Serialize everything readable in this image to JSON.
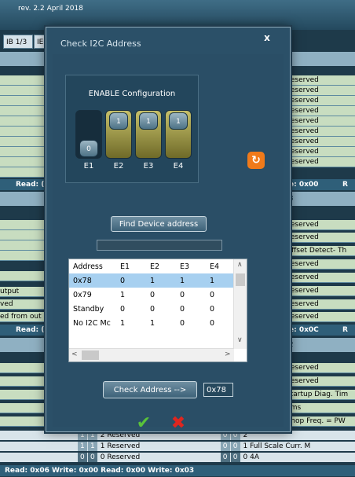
{
  "app": {
    "revision": "rev. 2.2 April 2018",
    "tabs": [
      "IB 1/3",
      "IE"
    ]
  },
  "background": {
    "right_rows_top": [
      "Reserved",
      "Reserved",
      "Reserved",
      "Reserved",
      "Reserved",
      "Reserved",
      "Reserved",
      "Reserved",
      "Reserved"
    ],
    "read_bar_1_left": "Read: (",
    "read_bar_1_right": "e: 0x00",
    "read_bar_1_far": "R",
    "section_1_num": "3",
    "right_rows_mid": [
      "Reserved",
      "Reserved",
      "Offset Detect- Th",
      "Reserved",
      "Reserved",
      "Reserved",
      "Reserved",
      "Reserved",
      "Reserved"
    ],
    "left_rows_mid": [
      "",
      "",
      "",
      "",
      "",
      "utput",
      "ved",
      "ed from out"
    ],
    "read_bar_2_left": "Read: (",
    "read_bar_2_right": "e: 0x0C",
    "read_bar_2_far": "R",
    "section_2_num": "2",
    "right_rows_low": [
      "Reserved",
      "Reserved",
      "Startup Diag. Tim",
      "0ms",
      "Chop Freq. = PW"
    ],
    "bottom_rows": [
      {
        "bits_left": [
          "1",
          "1"
        ],
        "label_left": "2 Reserved",
        "bits_right": [
          "0",
          "0"
        ],
        "label_right": "2"
      },
      {
        "bits_left": [
          "1",
          "1"
        ],
        "label_left": "1 Reserved",
        "bits_right": [
          "0",
          "0"
        ],
        "label_right": "1 Full Scale Curr. M"
      },
      {
        "bits_left": [
          "0",
          "0"
        ],
        "label_left": "0 Reserved",
        "bits_right": [
          "0",
          "0"
        ],
        "label_right": "0 4A"
      }
    ],
    "footer": "Read: 0x06    Write: 0x00    Read: 0x00    Write: 0x03"
  },
  "dialog": {
    "title": "Check I2C Address",
    "close_label": "x",
    "enable_label": "ENABLE Configuration",
    "switches": [
      {
        "name": "E1",
        "value": "0",
        "on": false
      },
      {
        "name": "E2",
        "value": "1",
        "on": true
      },
      {
        "name": "E3",
        "value": "1",
        "on": true
      },
      {
        "name": "E4",
        "value": "1",
        "on": true
      }
    ],
    "refresh_icon": "refresh-icon",
    "find_label": "Find Device address",
    "result_value": "",
    "table": {
      "headers": [
        "Address",
        "E1",
        "E2",
        "E3",
        "E4"
      ],
      "rows": [
        [
          "0x78",
          "0",
          "1",
          "1",
          "1"
        ],
        [
          "0x79",
          "1",
          "0",
          "0",
          "0"
        ],
        [
          "Standby",
          "0",
          "0",
          "0",
          "0"
        ],
        [
          "No I2C Mc",
          "1",
          "1",
          "0",
          "0"
        ]
      ],
      "selected_row": 0
    },
    "check_label": "Check Address -->",
    "check_result": "0x78",
    "ok_icon": "checkmark-icon",
    "cancel_icon": "red-x-icon"
  },
  "colors": {
    "accent_orange": "#f07a1a",
    "ok_green": "#59c23a",
    "cancel_red": "#e0261f",
    "switch_on": "#b8b25a",
    "row_green": "#c8ddc0"
  }
}
